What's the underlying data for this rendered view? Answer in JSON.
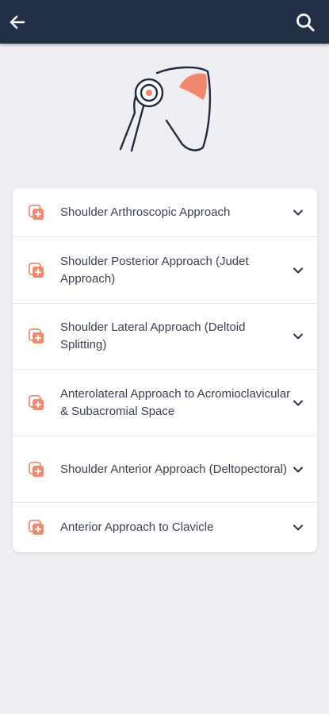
{
  "header": {
    "back_icon": "arrow-left-icon",
    "search_icon": "search-icon",
    "background_color": "#223046"
  },
  "hero": {
    "illustration": "shoulder-joint-illustration",
    "accent_color": "#f2896c"
  },
  "approaches": {
    "items": [
      {
        "label": "Shoulder Arthroscopic Approach"
      },
      {
        "label": "Shoulder Posterior Approach (Judet Approach)"
      },
      {
        "label": "Shoulder Lateral Approach (Deltoid Splitting)"
      },
      {
        "label": "Anterolateral Approach to Acromioclavicular & Subacromial Space"
      },
      {
        "label": "Shoulder Anterior Approach (Deltopectoral)"
      },
      {
        "label": "Anterior Approach to Clavicle"
      }
    ],
    "item_icon": "medical-add-icon",
    "expand_icon": "chevron-down-icon"
  }
}
